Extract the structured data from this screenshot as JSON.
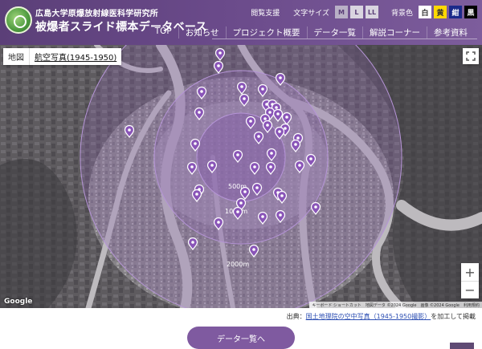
{
  "header": {
    "institute": "広島大学原爆放射線医科学研究所",
    "title": "被爆者スライド標本データベース",
    "tools": {
      "reading_support": "閲覧支援",
      "font_size_label": "文字サイズ",
      "sizes": [
        "M",
        "L",
        "LL"
      ],
      "bg_label": "背景色",
      "bg_colors": [
        "白",
        "黄",
        "紺",
        "黒"
      ]
    },
    "nav": [
      "TOP",
      "お知らせ",
      "プロジェクト概要",
      "データ一覧",
      "解説コーナー",
      "参考資料"
    ]
  },
  "map": {
    "tabs": [
      "地図",
      "航空写真(1945-1950)"
    ],
    "ring_labels": [
      "500m",
      "1000m",
      "2000m"
    ],
    "google": "Google",
    "attribution": "キーボード ショートカット　地図データ ©2024 Google　画像 ©2024 Google　利用規約"
  },
  "footer": {
    "source_prefix": "出典：",
    "source_link": "国土地理院の空中写真（1945-1950撮影）",
    "source_suffix": "を加工して掲載",
    "data_button": "データ一覧へ"
  },
  "colors": {
    "header": "#5b3f78",
    "pin": "#8a55b8",
    "button": "#7f5aa0"
  }
}
